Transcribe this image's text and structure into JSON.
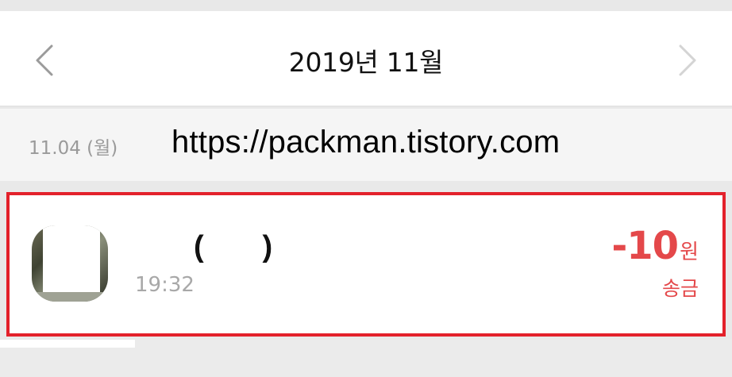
{
  "header": {
    "month_title": "2019년 11월",
    "prev_icon": "chevron-left-icon",
    "next_icon": "chevron-right-icon"
  },
  "date_group": {
    "date_label": "11.04 (월)"
  },
  "watermark": {
    "text": "https://packman.tistory.com"
  },
  "transaction": {
    "name": "(       )",
    "time": "19:32",
    "amount": "-10",
    "currency": "원",
    "type": "송금"
  },
  "colors": {
    "accent_red": "#e4484a",
    "highlight_border": "#e3212b",
    "muted_gray": "#9a9a9a"
  }
}
